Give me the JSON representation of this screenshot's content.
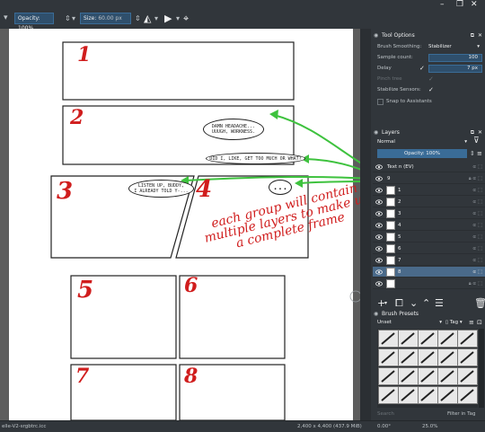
{
  "window": {
    "minimize_glyph": "–",
    "restore_glyph": "❐",
    "close_glyph": "✕"
  },
  "toolbar": {
    "opacity_label": "Opacity: 100%",
    "size_label": "Size:",
    "size_value": "60.00 px"
  },
  "canvas": {
    "panels": [
      {
        "number": "1"
      },
      {
        "number": "2"
      },
      {
        "number": "3"
      },
      {
        "number": "4"
      },
      {
        "number": "5"
      },
      {
        "number": "6"
      },
      {
        "number": "7"
      },
      {
        "number": "8"
      }
    ],
    "bubbles": {
      "b1": "DAMN HEADACHE...\nUUUGH, WORKNESS.",
      "b2": "DID I, LIKE, GET TOO MUCH OR WHAT?",
      "b3": "LISTEN UP, BUDDY,\nI ALREADY TOLD Y-...",
      "b4": "..."
    },
    "annotation": "each group will contain multiple layers to make up a complete frame"
  },
  "tool_options": {
    "title": "Tool Options",
    "rows": [
      {
        "label": "Brush Smoothing:",
        "value": "Stabilizer"
      },
      {
        "label": "Sample count:",
        "value": "100"
      },
      {
        "label": "Delay",
        "value": "7 px"
      },
      {
        "label": "Pinch tree",
        "value": ""
      },
      {
        "label": "Stabilize Sensors:",
        "value": ""
      },
      {
        "label": "Snap to Assistants",
        "value": ""
      }
    ]
  },
  "layers": {
    "title": "Layers",
    "blend_mode": "Normal",
    "opacity": "Opacity: 100%",
    "items": [
      {
        "name": "Text n (EV)",
        "selected": false
      },
      {
        "name": "9",
        "selected": false
      },
      {
        "name": "1",
        "selected": false
      },
      {
        "name": "2",
        "selected": false
      },
      {
        "name": "3",
        "selected": false
      },
      {
        "name": "4",
        "selected": false
      },
      {
        "name": "5",
        "selected": false
      },
      {
        "name": "6",
        "selected": false
      },
      {
        "name": "7",
        "selected": false
      },
      {
        "name": "8",
        "selected": true
      },
      {
        "name": "",
        "selected": false
      }
    ]
  },
  "brush_presets": {
    "title": "Brush Presets",
    "filter": "Unset",
    "tag_label": "Tag",
    "search_placeholder": "Search",
    "filter_in_tag": "Filter in Tag"
  },
  "status": {
    "profile": "elle-V2-srgbtrc.icc",
    "dimensions": "2,400 x 4,400 (437.9 MiB)",
    "rotation": "0.00°",
    "zoom": "25.0%"
  },
  "colors": {
    "accent": "#3daee9",
    "red_markup": "#d01d1d",
    "green_arrow": "#3ec23e",
    "selected_layer": "#4a6a8a"
  }
}
